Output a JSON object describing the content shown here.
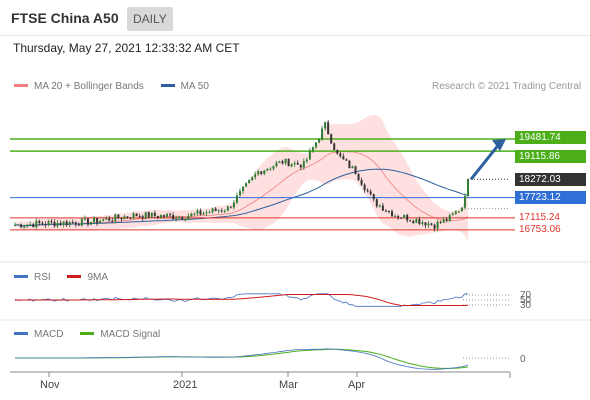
{
  "header": {
    "title": "FTSE China A50",
    "timeframe": "DAILY"
  },
  "datetime": "Thursday, May 27, 2021 12:33:32 AM CET",
  "legend": {
    "main": [
      {
        "label": "MA 20 + Bollinger Bands",
        "color": "#f08080"
      },
      {
        "label": "MA 50",
        "color": "#2f5f9e"
      }
    ],
    "rsi": [
      {
        "label": "RSI",
        "color": "#4472c4"
      },
      {
        "label": "9MA",
        "color": "#d11c1c"
      }
    ],
    "macd": [
      {
        "label": "MACD",
        "color": "#4472c4"
      },
      {
        "label": "MACD Signal",
        "color": "#4caf1a"
      }
    ]
  },
  "credit": "Research © 2021 Trading Central",
  "chart_data": {
    "type": "candlestick",
    "x_ticks": [
      "Nov",
      "2021",
      "Mar",
      "Apr"
    ],
    "y_range": [
      16300,
      20800
    ],
    "current_price": 18272.03,
    "levels": [
      {
        "value": 19481.74,
        "label": "19481.74",
        "kind": "target",
        "color": "#4caf1a"
      },
      {
        "value": 19115.86,
        "label": "19115.86",
        "kind": "resistance",
        "color": "#4caf1a"
      },
      {
        "value": 18272.03,
        "label": "18272.03",
        "kind": "last",
        "color": "#333333"
      },
      {
        "value": 17723.12,
        "label": "17723.12",
        "kind": "pivot",
        "color": "#2f6fd6"
      },
      {
        "value": 17115.24,
        "label": "17115.24",
        "kind": "support",
        "color": "#e0352b"
      },
      {
        "value": 16753.06,
        "label": "16753.06",
        "kind": "support",
        "color": "#e0352b"
      }
    ],
    "rsi_levels": [
      70,
      50,
      30
    ],
    "macd_levels": [
      0
    ]
  }
}
